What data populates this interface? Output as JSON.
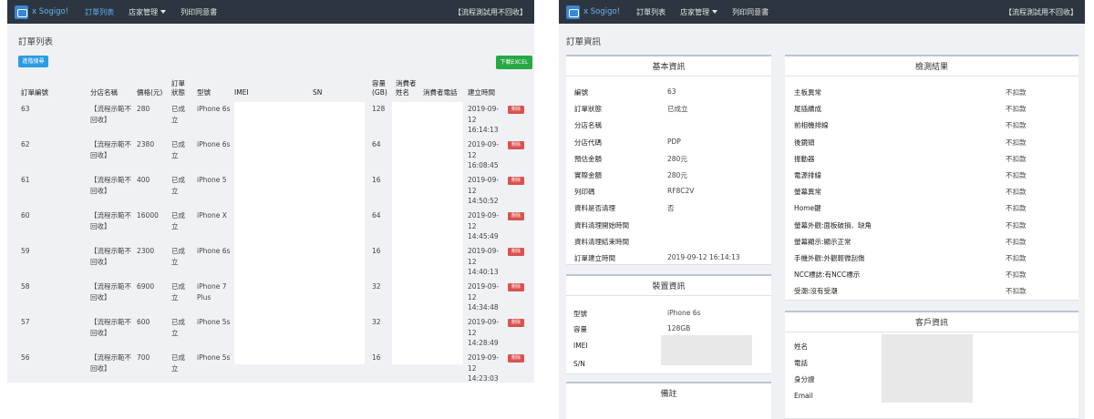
{
  "nav": {
    "brand": "x Sogigo!",
    "orders": "訂單列表",
    "store_manage": "店家管理",
    "print_consent": "列印同意書",
    "notice": "【流程測試用不回收】"
  },
  "list": {
    "title": "訂單列表",
    "advanced_search": "進階搜尋",
    "download_excel": "下載EXCEL",
    "headers": {
      "order_no": "訂單編號",
      "store_name": "分店名稱",
      "price": "價格(元)",
      "status_a": "訂單",
      "status_b": "狀態",
      "model": "型號",
      "imei": "IMEI",
      "sn": "SN",
      "capacity_a": "容量",
      "capacity_b": "(GB)",
      "consumer_a": "消費者",
      "consumer_b": "姓名",
      "phone": "消費者電話",
      "created": "建立時間"
    },
    "rows": [
      {
        "id": "63",
        "store_a": "【流程示範不",
        "store_b": "回收】",
        "price": "280",
        "status_a": "已成",
        "status_b": "立",
        "model_a": "iPhone 6s",
        "model_b": "",
        "cap": "128",
        "d1": "2019-09-",
        "d2": "12",
        "d3": "16:14:13",
        "delete": "刪除"
      },
      {
        "id": "62",
        "store_a": "【流程示範不",
        "store_b": "回收】",
        "price": "2380",
        "status_a": "已成",
        "status_b": "立",
        "model_a": "iPhone 6s",
        "model_b": "",
        "cap": "64",
        "d1": "2019-09-",
        "d2": "12",
        "d3": "16:08:45",
        "delete": "刪除"
      },
      {
        "id": "61",
        "store_a": "【流程示範不",
        "store_b": "回收】",
        "price": "400",
        "status_a": "已成",
        "status_b": "立",
        "model_a": "iPhone 5",
        "model_b": "",
        "cap": "16",
        "d1": "2019-09-",
        "d2": "12",
        "d3": "14:50:52",
        "delete": "刪除"
      },
      {
        "id": "60",
        "store_a": "【流程示範不",
        "store_b": "回收】",
        "price": "16000",
        "status_a": "已成",
        "status_b": "立",
        "model_a": "iPhone X",
        "model_b": "",
        "cap": "64",
        "d1": "2019-09-",
        "d2": "12",
        "d3": "14:45:49",
        "delete": "刪除"
      },
      {
        "id": "59",
        "store_a": "【流程示範不",
        "store_b": "回收】",
        "price": "2300",
        "status_a": "已成",
        "status_b": "立",
        "model_a": "iPhone 6s",
        "model_b": "",
        "cap": "16",
        "d1": "2019-09-",
        "d2": "12",
        "d3": "14:40:13",
        "delete": "刪除"
      },
      {
        "id": "58",
        "store_a": "【流程示範不",
        "store_b": "回收】",
        "price": "6900",
        "status_a": "已成",
        "status_b": "立",
        "model_a": "iPhone 7",
        "model_b": "Plus",
        "cap": "32",
        "d1": "2019-09-",
        "d2": "12",
        "d3": "14:34:48",
        "delete": "刪除"
      },
      {
        "id": "57",
        "store_a": "【流程示範不",
        "store_b": "回收】",
        "price": "600",
        "status_a": "已成",
        "status_b": "立",
        "model_a": "iPhone 5s",
        "model_b": "",
        "cap": "32",
        "d1": "2019-09-",
        "d2": "12",
        "d3": "14:28:49",
        "delete": "刪除"
      },
      {
        "id": "56",
        "store_a": "【流程示範不",
        "store_b": "回收】",
        "price": "700",
        "status_a": "已成",
        "status_b": "立",
        "model_a": "iPhone 5s",
        "model_b": "",
        "cap": "16",
        "d1": "2019-09-",
        "d2": "12",
        "d3": "14:23:03",
        "delete": "刪除"
      }
    ]
  },
  "detail": {
    "title": "訂單資訊",
    "basic": {
      "heading": "基本資訊",
      "fields": [
        {
          "label": "編號",
          "value": "63"
        },
        {
          "label": "訂單狀態",
          "value": "已成立"
        },
        {
          "label": "分店名稱",
          "value": ""
        },
        {
          "label": "分店代碼",
          "value": "PDP"
        },
        {
          "label": "預估金額",
          "value": "280元"
        },
        {
          "label": "實際金額",
          "value": "280元"
        },
        {
          "label": "列印碼",
          "value": "RF8C2V"
        },
        {
          "label": "資料是否清理",
          "value": "否"
        },
        {
          "label": "資料清理開始時間",
          "value": ""
        },
        {
          "label": "資料清理結束時間",
          "value": ""
        },
        {
          "label": "訂單建立時間",
          "value": "2019-09-12 16:14:13"
        }
      ]
    },
    "device": {
      "heading": "裝置資訊",
      "fields": [
        {
          "label": "型號",
          "value": "iPhone 6s"
        },
        {
          "label": "容量",
          "value": "128GB"
        },
        {
          "label": "IMEI",
          "value": ""
        },
        {
          "label": "S/N",
          "value": ""
        }
      ]
    },
    "note": {
      "heading": "備註"
    },
    "inspection": {
      "heading": "檢測結果",
      "fields": [
        {
          "label": "主板異常",
          "value": "不扣款"
        },
        {
          "label": "尾插續成",
          "value": "不扣款"
        },
        {
          "label": "前相機排線",
          "value": "不扣款"
        },
        {
          "label": "後鏡頭",
          "value": "不扣款"
        },
        {
          "label": "振動器",
          "value": "不扣款"
        },
        {
          "label": "電源排線",
          "value": "不扣款"
        },
        {
          "label": "螢幕異常",
          "value": "不扣款"
        },
        {
          "label": "Home鍵",
          "value": "不扣款"
        },
        {
          "label": "螢幕外觀:面板破損、缺角",
          "value": "不扣款"
        },
        {
          "label": "螢幕顯示:顯示正常",
          "value": "不扣款"
        },
        {
          "label": "手機外觀:外觀輕微刮傷",
          "value": "不扣款"
        },
        {
          "label": "NCC標誌:有NCC標示",
          "value": "不扣款"
        },
        {
          "label": "受潮:沒有受潮",
          "value": "不扣款"
        }
      ]
    },
    "customer": {
      "heading": "客戶資訊",
      "fields": [
        {
          "label": "姓名"
        },
        {
          "label": "電話"
        },
        {
          "label": "身分證"
        },
        {
          "label": "Email"
        }
      ]
    }
  }
}
